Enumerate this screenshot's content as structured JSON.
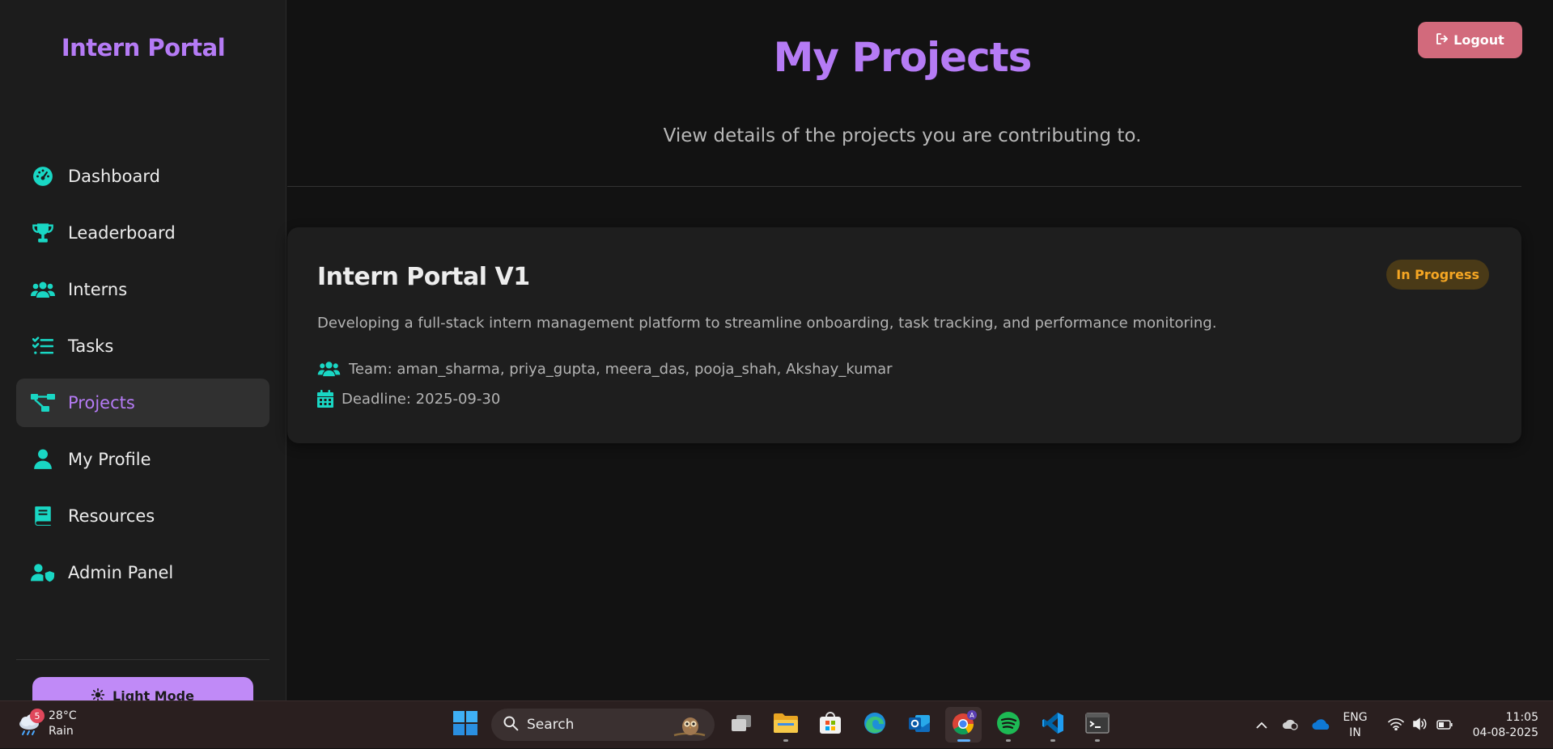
{
  "sidebar": {
    "brand": "Intern Portal",
    "items": [
      {
        "label": "Dashboard",
        "icon": "dashboard-gauge-icon"
      },
      {
        "label": "Leaderboard",
        "icon": "trophy-icon"
      },
      {
        "label": "Interns",
        "icon": "users-icon"
      },
      {
        "label": "Tasks",
        "icon": "task-list-icon"
      },
      {
        "label": "Projects",
        "icon": "project-diagram-icon",
        "active": true
      },
      {
        "label": "My Profile",
        "icon": "user-icon"
      },
      {
        "label": "Resources",
        "icon": "book-icon"
      },
      {
        "label": "Admin Panel",
        "icon": "user-shield-icon"
      }
    ],
    "mode_button": "Light Mode"
  },
  "header": {
    "title": "My Projects",
    "subtitle": "View details of the projects you are contributing to.",
    "logout": "Logout"
  },
  "projects": [
    {
      "title": "Intern Portal V1",
      "status": "In Progress",
      "description": "Developing a full-stack intern management platform to streamline onboarding, task tracking, and performance monitoring.",
      "team": "Team: aman_sharma, priya_gupta, meera_das, pooja_shah, Akshay_kumar",
      "deadline": "Deadline: 2025-09-30"
    }
  ],
  "colors": {
    "accent": "#b57bf5",
    "icon": "#19d7c4",
    "logout": "#d26a7c",
    "badge_text": "#f5a623"
  },
  "taskbar": {
    "weather_badge": "5",
    "temperature": "28°C",
    "condition": "Rain",
    "search_placeholder": "Search",
    "language_line1": "ENG",
    "language_line2": "IN",
    "time": "11:05",
    "date": "04-08-2025"
  }
}
